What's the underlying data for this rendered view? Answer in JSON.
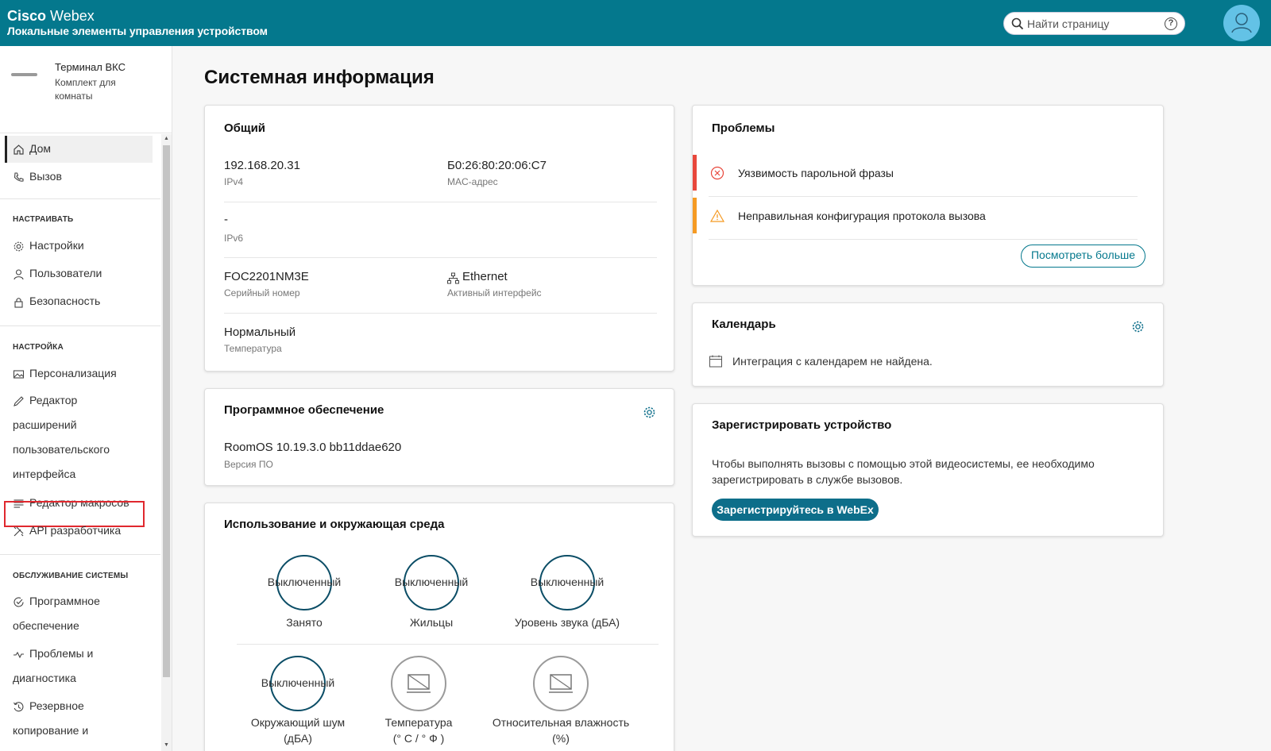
{
  "header": {
    "brand_cisco": "Cisco",
    "brand_webex": "Webex",
    "subtitle": "Локальные элементы управления устройством",
    "search_placeholder": "Найти страницу",
    "help_glyph": "?"
  },
  "sidebar": {
    "device_name": "Терминал ВКС",
    "device_type": "Комплект для комнаты",
    "items": [
      {
        "label": "Дом",
        "icon": "home-icon"
      },
      {
        "label": "Вызов",
        "icon": "phone-icon"
      }
    ],
    "section_customize": "НАСТРАИВАТЬ",
    "customize_items": [
      {
        "label": "Настройки",
        "icon": "gear-icon"
      },
      {
        "label": "Пользователи",
        "icon": "user-icon"
      },
      {
        "label": "Безопасность",
        "icon": "lock-icon"
      }
    ],
    "section_setup": "НАСТРОЙКА",
    "setup_items": [
      {
        "label": "Персонализация",
        "icon": "image-icon"
      },
      {
        "label_lines": [
          "Редактор",
          "расширений",
          "пользовательского",
          "интерфейса"
        ],
        "icon": "pencil-icon"
      },
      {
        "label": "Редактор макросов",
        "icon": "list-icon"
      },
      {
        "label": "API разработчика",
        "icon": "tools-icon"
      }
    ],
    "section_maintenance": "ОБСЛУЖИВАНИЕ СИСТЕМЫ",
    "maintenance_items": [
      {
        "label_lines": [
          "Программное",
          "обеспечение"
        ],
        "icon": "software-icon"
      },
      {
        "label_lines": [
          "Проблемы и",
          "диагностика"
        ],
        "icon": "pulse-icon"
      },
      {
        "label_lines": [
          "Резервное",
          "копирование и"
        ],
        "icon": "restore-icon"
      }
    ]
  },
  "main": {
    "page_title": "Системная информация",
    "general": {
      "title": "Общий",
      "ipv4_value": "192.168.20.31",
      "ipv4_label": "IPv4",
      "mac_value": "Б0:26:80:20:06:C7",
      "mac_label": "MAC-адрес",
      "ipv6_value": "-",
      "ipv6_label": "IPv6",
      "serial_value": "FOC2201NM3E",
      "serial_label": "Серийный номер",
      "interface_value": "Ethernet",
      "interface_label": "Активный интерфейс",
      "temp_value": "Нормальный",
      "temp_label": "Температура"
    },
    "software": {
      "title": "Программное обеспечение",
      "version_value": "RoomOS 10.19.3.0 bb11ddae620",
      "version_label": "Версия ПО"
    },
    "usage": {
      "title": "Использование и окружающая среда",
      "ring_text": "Выключенный",
      "metrics": [
        {
          "label": "Занято"
        },
        {
          "label": "Жильцы"
        },
        {
          "label": "Уровень звука (дБА)"
        },
        {
          "label_lines": [
            "Окружающий шум",
            "(дБА)"
          ]
        },
        {
          "label_lines": [
            "Температура",
            "(° C / ° Ф )"
          ]
        },
        {
          "label_lines": [
            "Относительная влажность",
            "(%)"
          ]
        }
      ]
    },
    "issues": {
      "title": "Проблемы",
      "items": [
        {
          "label": "Уязвимость парольной фразы",
          "severity_color": "#e8473b",
          "icon": "error-circle-icon"
        },
        {
          "label": "Неправильная конфигурация протокола вызова",
          "severity_color": "#f59a23",
          "icon": "warning-triangle-icon"
        }
      ],
      "more_button": "Посмотреть больше"
    },
    "calendar": {
      "title": "Календарь",
      "message": "Интеграция с календарем не найдена."
    },
    "register": {
      "title": "Зарегистрировать устройство",
      "text_line1": "Чтобы выполнять вызовы с помощью этой видеосистемы, ее необходимо",
      "text_line2": "зарегистрировать в службе вызовов.",
      "button": "Зарегистрируйтесь в WebEx"
    }
  },
  "colors": {
    "header_bg": "#04788d",
    "accent": "#0d6e8a",
    "error": "#e8473b",
    "warning": "#f59a23",
    "highlight_box": "#e0282e"
  }
}
